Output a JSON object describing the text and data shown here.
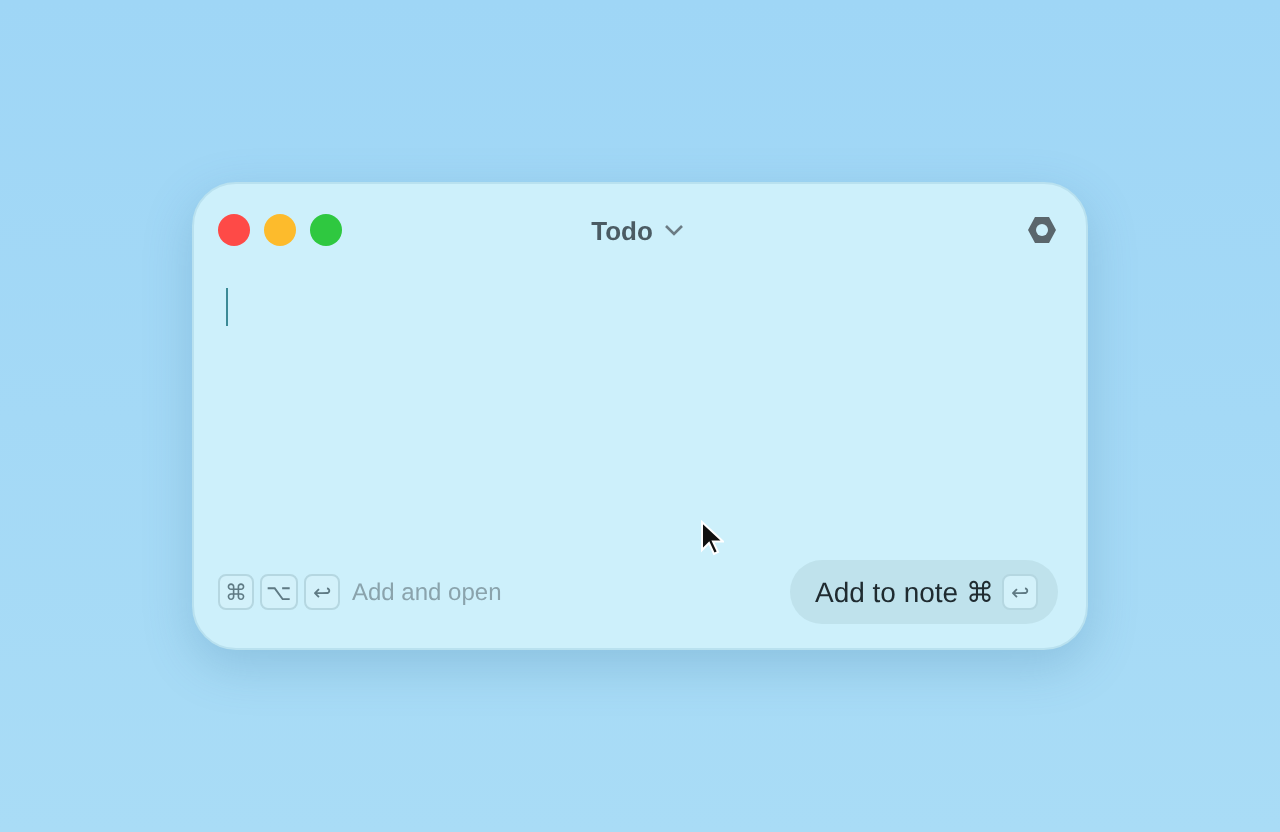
{
  "window": {
    "title": "Todo",
    "traffic_lights": [
      {
        "color": "#fe4a47"
      },
      {
        "color": "#fdbb2c"
      },
      {
        "color": "#2fc840"
      }
    ]
  },
  "editor": {
    "focused": true
  },
  "footer": {
    "shortcut_keys": [
      "⌘",
      "⌥",
      "↩"
    ],
    "shortcut_label": "Add and open",
    "primary_button": {
      "label": "Add to note",
      "shortcut_modifier": "⌘",
      "shortcut_key": "↩"
    }
  }
}
